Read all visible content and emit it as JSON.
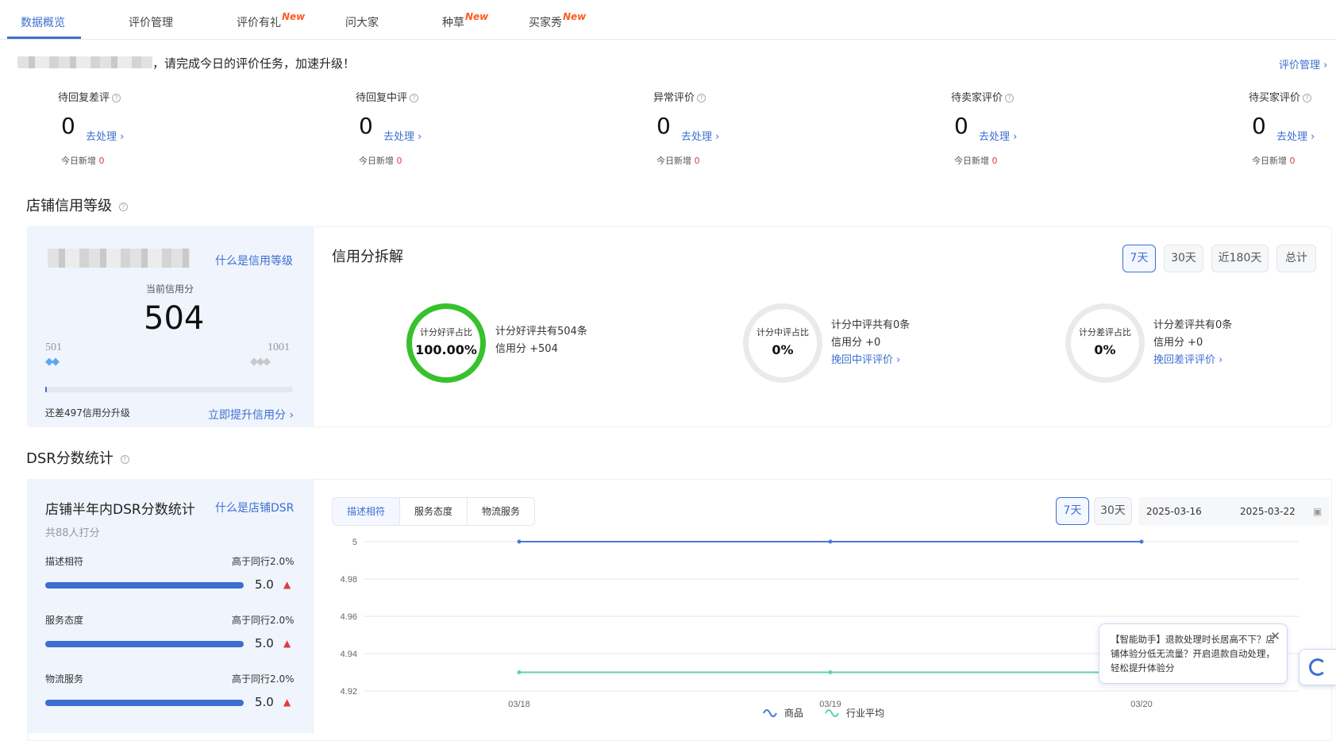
{
  "tabs": [
    {
      "label": "数据概览",
      "new": ""
    },
    {
      "label": "评价管理",
      "new": ""
    },
    {
      "label": "评价有礼",
      "new": "New"
    },
    {
      "label": "问大家",
      "new": ""
    },
    {
      "label": "种草",
      "new": "New"
    },
    {
      "label": "买家秀",
      "new": "New"
    }
  ],
  "notice": {
    "text": "，请完成今日的评价任务，加速升级！",
    "link": "评价管理 ›"
  },
  "stats": [
    {
      "label": "待回复差评",
      "value": "0",
      "action": "去处理 ›",
      "today_label": "今日新增",
      "today_value": "0"
    },
    {
      "label": "待回复中评",
      "value": "0",
      "action": "去处理 ›",
      "today_label": "今日新增",
      "today_value": "0"
    },
    {
      "label": "异常评价",
      "value": "0",
      "action": "去处理 ›",
      "today_label": "今日新增",
      "today_value": "0"
    },
    {
      "label": "待卖家评价",
      "value": "0",
      "action": "去处理 ›",
      "today_label": "今日新增",
      "today_value": "0"
    },
    {
      "label": "待买家评价",
      "value": "0",
      "action": "去处理 ›",
      "today_label": "今日新增",
      "today_value": "0"
    }
  ],
  "credit": {
    "section_title": "店铺信用等级",
    "what_link": "什么是信用等级",
    "current_label": "当前信用分",
    "score": "504",
    "level_min": "501",
    "level_max": "1001",
    "progress": 0.006,
    "remain_text": "还差497信用分升级",
    "improve_link": "立即提升信用分 ›",
    "breakdown_title": "信用分拆解",
    "periods": [
      "7天",
      "30天",
      "近180天",
      "总计"
    ],
    "active_period": 0,
    "rings": [
      {
        "label": "计分好评占比",
        "value": "100.00%",
        "line1": "计分好评共有504条",
        "line2": "信用分 +504",
        "link": "",
        "color": "#37c12c"
      },
      {
        "label": "计分中评占比",
        "value": "0%",
        "line1": "计分中评共有0条",
        "line2": "信用分 +0",
        "link": "挽回中评评价 ›",
        "color": "#eaeaea"
      },
      {
        "label": "计分差评占比",
        "value": "0%",
        "line1": "计分差评共有0条",
        "line2": "信用分 +0",
        "link": "挽回差评评价 ›",
        "color": "#eaeaea"
      }
    ]
  },
  "dsr": {
    "section_title": "DSR分数统计",
    "card_title": "店铺半年内DSR分数统计",
    "what_link": "什么是店铺DSR",
    "rater_count": "共88人打分",
    "rows": [
      {
        "name": "描述相符",
        "compare": "高于同行2.0%",
        "score": "5.0"
      },
      {
        "name": "服务态度",
        "compare": "高于同行2.0%",
        "score": "5.0"
      },
      {
        "name": "物流服务",
        "compare": "高于同行2.0%",
        "score": "5.0"
      }
    ],
    "segments": [
      "描述相符",
      "服务态度",
      "物流服务"
    ],
    "active_segment": 0,
    "periods": [
      "7天",
      "30天"
    ],
    "active_period": 0,
    "date_start": "2025-03-16",
    "date_end": "2025-03-22"
  },
  "chart_data": {
    "type": "line",
    "x": [
      "03/18",
      "03/19",
      "03/20"
    ],
    "ylim": [
      4.92,
      5
    ],
    "yticks": [
      "5",
      "4.98",
      "4.96",
      "4.94",
      "4.92"
    ],
    "series": [
      {
        "name": "商品",
        "values": [
          5,
          5,
          5
        ],
        "color": "#4a78d6"
      },
      {
        "name": "行业平均",
        "values": [
          4.93,
          4.93,
          4.93
        ],
        "color": "#5fd0ad"
      }
    ],
    "grid": true,
    "legend": "bottom"
  },
  "assistant_tip": "【智能助手】退款处理时长居高不下？店铺体验分低无流量？开启退款自动处理，轻松提升体验分"
}
